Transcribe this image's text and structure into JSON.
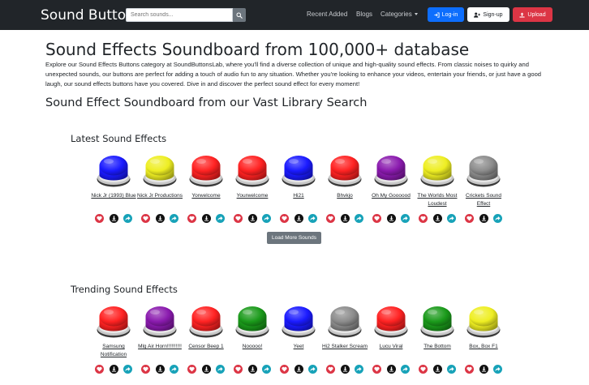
{
  "header": {
    "brand": "Sound Buttons",
    "search_placeholder": "Search sounds...",
    "nav": {
      "recent": "Recent Added",
      "blogs": "Blogs",
      "categories": "Categories"
    },
    "login": "Log-in",
    "signup": "Sign-up",
    "upload": "Upload"
  },
  "page": {
    "title": "Sound Effects Soundboard from 100,000+ database",
    "intro": "Explore our Sound Effects Buttons category at SoundButtonsLab, where you'll find a diverse collection of unique and high-quality sound effects. From classic noises to quirky and unexpected sounds, our buttons are perfect for adding a touch of audio fun to any situation. Whether you're looking to enhance your videos, entertain your friends, or just have a good laugh, our sound effects buttons have you covered. Dive in and discover the perfect sound effect for every moment!",
    "library_heading": "Sound Effect Soundboard from our Vast Library Search"
  },
  "latest": {
    "heading": "Latest Sound Effects",
    "load_more": "Load More Sounds",
    "items": [
      {
        "label": "Nick Jr (1993) Blue",
        "color": "#1a1aff"
      },
      {
        "label": "Nick Jr Productions",
        "color": "#eeee22"
      },
      {
        "label": "Yorwelcome",
        "color": "#ff2222"
      },
      {
        "label": "Yourwelcome",
        "color": "#ff2222"
      },
      {
        "label": "Hi21",
        "color": "#1a1aff"
      },
      {
        "label": "Bhvkjo",
        "color": "#ff2222"
      },
      {
        "label": "Oh My Goooood",
        "color": "#8a1aae"
      },
      {
        "label": "The Worlds Most Loudest",
        "color": "#eeee22"
      },
      {
        "label": "Crickets Sound Effect",
        "color": "#8c8c8c"
      }
    ]
  },
  "trending": {
    "heading": "Trending Sound Effects",
    "items": [
      {
        "label": "Samsung Notification",
        "color": "#ff2222"
      },
      {
        "label": "Mlg Air Horn!!!!!!!!!!",
        "color": "#8a1aae"
      },
      {
        "label": "Censor Beep 1",
        "color": "#ff2222"
      },
      {
        "label": "Nooooo!",
        "color": "#1a9a1a"
      },
      {
        "label": "Yeet",
        "color": "#1a1aff"
      },
      {
        "label": "Hi2 Stalker Scream",
        "color": "#8c8c8c"
      },
      {
        "label": "Lucu Viral",
        "color": "#ff2222"
      },
      {
        "label": "The Bottom",
        "color": "#1a9a1a"
      },
      {
        "label": "Box, Box F1",
        "color": "#eeee22"
      }
    ]
  }
}
